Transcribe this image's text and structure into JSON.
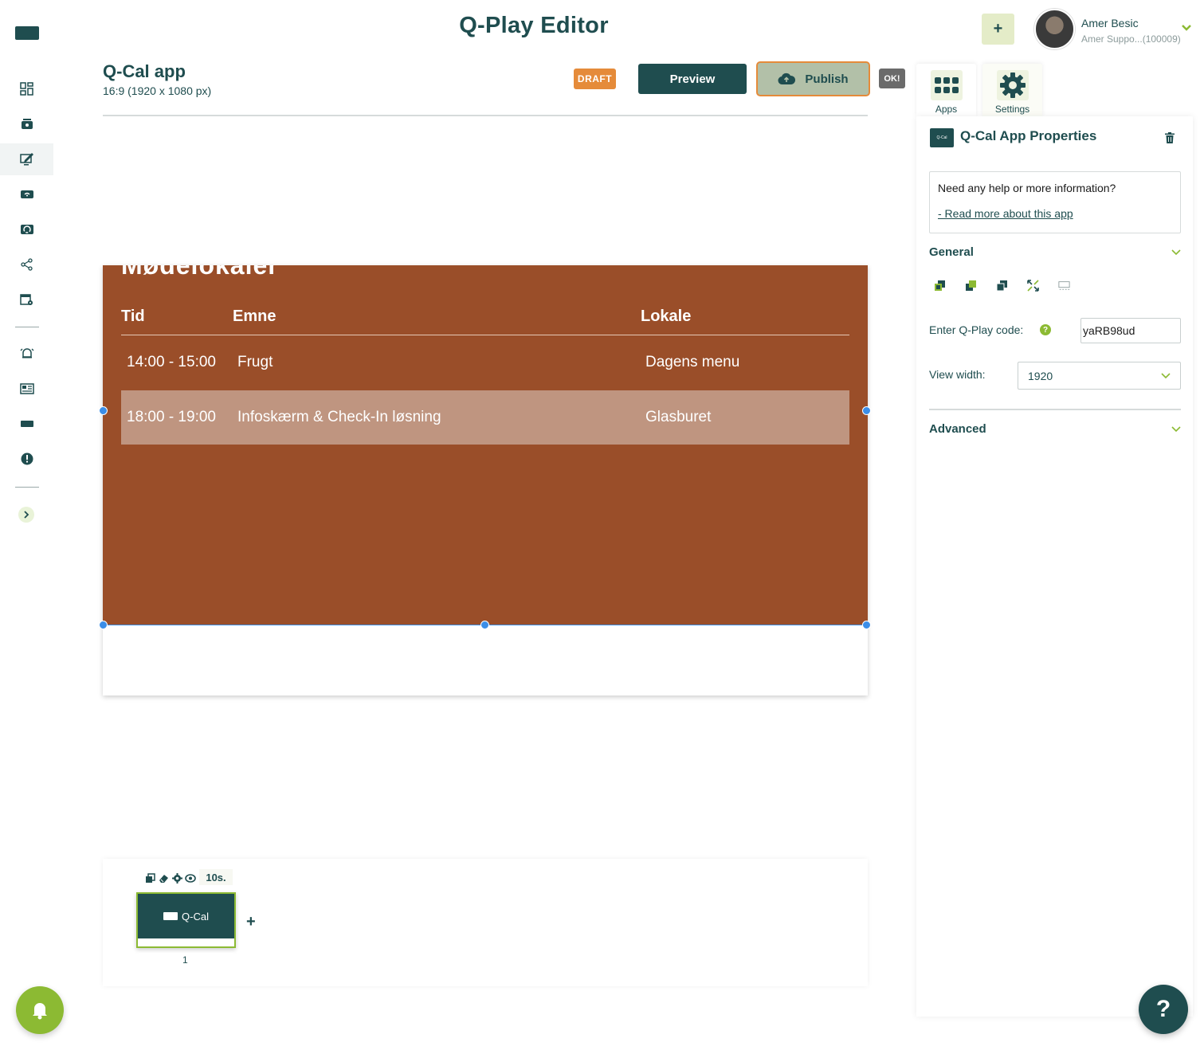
{
  "header": {
    "title": "Q-Play Editor",
    "add_label": "+",
    "user": {
      "name": "Amer Besic",
      "subtitle": "Amer Suppo...(100009)"
    }
  },
  "project": {
    "title": "Q-Cal app",
    "resolution": "16:9 (1920 x 1080 px)",
    "status": "DRAFT",
    "preview_label": "Preview",
    "publish_label": "Publish",
    "ok_label": "OK!"
  },
  "tabs": [
    {
      "label": "Apps",
      "icon": "grid-dots-icon"
    },
    {
      "label": "Settings",
      "icon": "gear-icon"
    }
  ],
  "panel": {
    "icon_text": "Q-Cal",
    "title": "Q-Cal App Properties",
    "help_question": "Need any help or more information?",
    "help_link": "- Read more about this app",
    "general_label": "General",
    "code_label": "Enter Q-Play code:",
    "code_value": "yaRB98ud",
    "width_label": "View width:",
    "width_value": "1920",
    "advanced_label": "Advanced"
  },
  "canvas": {
    "heading": "Mødelokaler",
    "columns": [
      "Tid",
      "Emne",
      "Lokale"
    ],
    "rows": [
      {
        "time": "14:00 - 15:00",
        "subject": "Frugt",
        "room": "Dagens menu",
        "highlight": false
      },
      {
        "time": "18:00 - 19:00",
        "subject": "Infoskærm & Check-In løsning",
        "room": "Glasburet",
        "highlight": true
      }
    ],
    "background_color": "#9a4e29"
  },
  "timeline": {
    "duration": "10s.",
    "slides": [
      {
        "label": "Q-Cal",
        "number": "1"
      }
    ],
    "add_label": "+"
  },
  "help_fab_label": "?",
  "colors": {
    "primary": "#1f4d4f",
    "accent": "#8cba33",
    "draft": "#e58b3a"
  }
}
